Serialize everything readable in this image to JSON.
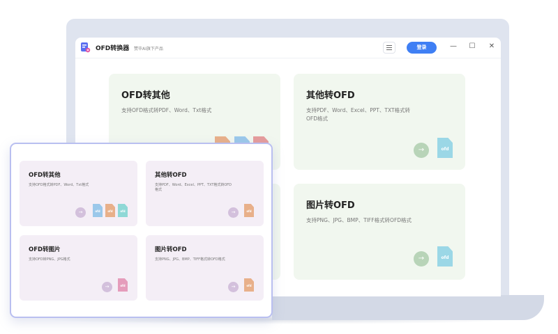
{
  "app": {
    "title": "OFD转换器",
    "subtitle": "赞毕AI旗下产品",
    "login_label": "登录",
    "menu_icon": "hamburger-icon",
    "controls": {
      "minimize": "—",
      "maximize": "☐",
      "close": "✕"
    }
  },
  "big_cards": [
    {
      "title": "OFD转其他",
      "desc": "支持OFD格式转PDF、Word、Txt格式"
    },
    {
      "title": "其他转OFD",
      "desc": "支持PDF、Word、Excel、PPT、TXT格式转OFD格式"
    },
    {
      "title": "图片转OFD",
      "desc": "支持PNG、JPG、BMP、TIFF格式转OFD格式"
    }
  ],
  "panel_cards": [
    {
      "title": "OFD转其他",
      "desc": "支持OFD格式转PDF、Word、Txt格式"
    },
    {
      "title": "其他转OFD",
      "desc": "支持PDF、Word、Excel、PPT、TXT格式转OFD格式"
    },
    {
      "title": "OFD转图片",
      "desc": "支持OFD转PNG、JPG格式"
    },
    {
      "title": "图片转OFD",
      "desc": "支持PNG、JPG、BMP、TIFF格式转OFD格式"
    }
  ],
  "file_glyph": "ofd",
  "arrow": "→",
  "colors": {
    "accent": "#3f7ff4",
    "big_card_bg": "#f1f7ef",
    "panel_card_bg": "#f4eef6",
    "file_blue": "#9bd7e6",
    "file_orange": "#e8b08a",
    "file_pink": "#e59c9c",
    "file_teal": "#8fd8d6"
  }
}
